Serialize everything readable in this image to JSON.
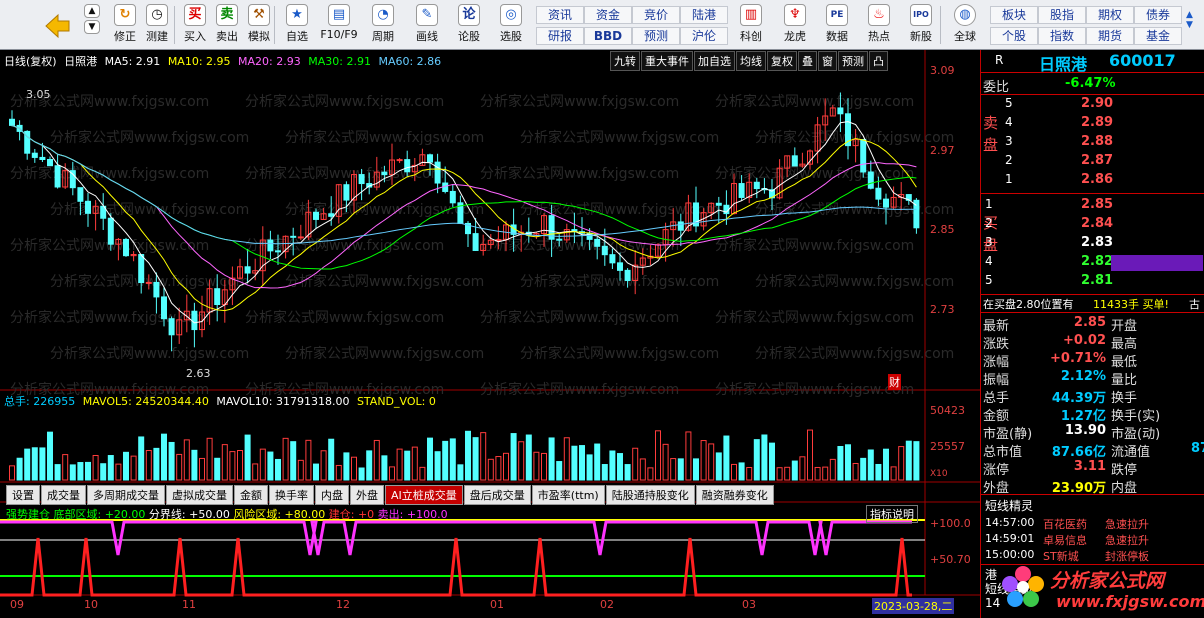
{
  "toolbar": {
    "items": [
      {
        "label": "修正",
        "icon": "refresh-icon"
      },
      {
        "label": "测建",
        "icon": "clock-icon"
      },
      {
        "label": "买入",
        "icon": "buy-icon"
      },
      {
        "label": "卖出",
        "icon": "sell-icon"
      },
      {
        "label": "模拟",
        "icon": "hammer-icon"
      },
      {
        "label": "自选",
        "icon": "star-icon"
      },
      {
        "label": "F10/F9",
        "icon": "doc-icon"
      },
      {
        "label": "周期",
        "icon": "cycle-icon"
      },
      {
        "label": "画线",
        "icon": "pencil-icon"
      },
      {
        "label": "论股",
        "icon": "discuss-icon"
      },
      {
        "label": "选股",
        "icon": "select-icon"
      },
      {
        "label": "科创",
        "icon": "chart-icon"
      },
      {
        "label": "龙虎",
        "icon": "dragon-icon"
      },
      {
        "label": "数据",
        "icon": "pe-icon"
      },
      {
        "label": "热点",
        "icon": "fire-icon"
      },
      {
        "label": "新股",
        "icon": "ipo-icon"
      },
      {
        "label": "全球",
        "icon": "globe-icon"
      }
    ],
    "small": [
      "资讯",
      "资金",
      "竞价",
      "陆港",
      "研报",
      "BBD",
      "预测",
      "沪伦",
      "板块",
      "股指",
      "期权",
      "债券",
      "个股",
      "指数",
      "期货",
      "基金"
    ],
    "buy_glyph": "买",
    "sell_glyph": "卖",
    "discuss_glyph": "论",
    "pe_glyph": "PE",
    "ipo_glyph": "IPO"
  },
  "chart": {
    "ma_title": "日线(复权)",
    "stock_name": "日照港",
    "ma": [
      {
        "t": "MA5: 2.91",
        "c": "#ffffff"
      },
      {
        "t": "MA10: 2.95",
        "c": "#ffff00"
      },
      {
        "t": "MA20: 2.93",
        "c": "#ff66ff"
      },
      {
        "t": "MA30: 2.91",
        "c": "#00ff00"
      },
      {
        "t": "MA60: 2.86",
        "c": "#66ccff"
      }
    ],
    "top_buttons": [
      "九转",
      "重大事件",
      "加自选",
      "均线",
      "复权",
      "叠",
      "窗",
      "预测",
      "凸"
    ],
    "price_axis": [
      "3.09",
      "2.97",
      "2.85",
      "2.73"
    ],
    "high_label": "3.05",
    "low_label": "2.63",
    "cai_label": "财",
    "vol_info": [
      {
        "t": "总手: 226955",
        "c": "#00c8ff"
      },
      {
        "t": "MAVOL5: 24520344.40",
        "c": "#ffff00"
      },
      {
        "t": "MAVOL10: 31791318.00",
        "c": "#ffffff"
      },
      {
        "t": "STAND_VOL: 0",
        "c": "#ffff00"
      }
    ],
    "vol_axis": [
      "50423",
      "25557",
      "X10"
    ],
    "tabs": [
      "设置",
      "成交量",
      "多周期成交量",
      "虚拟成交量",
      "金额",
      "换手率",
      "内盘",
      "外盘",
      "AI立桩成交量",
      "盘后成交量",
      "市盈率(ttm)",
      "陆股通持股变化",
      "融资融券变化"
    ],
    "tab_active": "AI立桩成交量",
    "ind": [
      {
        "t": "强势建仓 底部区域: +20.00",
        "c": "#00ff00"
      },
      {
        "t": "分界线: +50.00",
        "c": "#ffffff"
      },
      {
        "t": "风险区域: +80.00",
        "c": "#ffff00"
      },
      {
        "t": "建仓: +0",
        "c": "#ff3333"
      },
      {
        "t": "卖出: +100.0",
        "c": "#ff33ff"
      }
    ],
    "ind_button": "指标说明",
    "ind_axis": [
      "+100.0",
      "+50.70"
    ],
    "dates": [
      "09",
      "10",
      "11",
      "12",
      "01",
      "02",
      "03"
    ],
    "cur_date": "2023-03-28,二"
  },
  "quote": {
    "r": "R",
    "name": "日照港",
    "code": "600017",
    "weibi_label": "委比",
    "weibi": "-6.47%",
    "sell_label": "卖盘",
    "buy_label": "买盘",
    "sells": [
      {
        "n": "5",
        "p": "2.90"
      },
      {
        "n": "4",
        "p": "2.89"
      },
      {
        "n": "3",
        "p": "2.88"
      },
      {
        "n": "2",
        "p": "2.87"
      },
      {
        "n": "1",
        "p": "2.86"
      }
    ],
    "buys": [
      {
        "n": "1",
        "p": "2.85"
      },
      {
        "n": "2",
        "p": "2.84"
      },
      {
        "n": "3",
        "p": "2.83"
      },
      {
        "n": "4",
        "p": "2.82"
      },
      {
        "n": "5",
        "p": "2.81"
      }
    ],
    "notice": "在买盘2.80位置有",
    "notice2": "11433手 买单!",
    "notice3": "古",
    "stats": [
      {
        "l": "最新",
        "v": "2.85",
        "l2": "开盘"
      },
      {
        "l": "涨跌",
        "v": "+0.02",
        "l2": "最高"
      },
      {
        "l": "涨幅",
        "v": "+0.71%",
        "l2": "最低"
      },
      {
        "l": "振幅",
        "v": "2.12%",
        "l2": "量比"
      },
      {
        "l": "总手",
        "v": "44.39万",
        "l2": "换手"
      },
      {
        "l": "金额",
        "v": "1.27亿",
        "l2": "换手(实)"
      },
      {
        "l": "市盈(静)",
        "v": "13.90",
        "l2": "市盈(动)"
      },
      {
        "l": "总市值",
        "v": "87.66亿",
        "l2": "流通值",
        "v2": "87"
      },
      {
        "l": "涨停",
        "v": "3.11",
        "l2": "跌停"
      },
      {
        "l": "外盘",
        "v": "23.90万",
        "l2": "内盘"
      }
    ],
    "wizard": "短线精灵",
    "alerts": [
      {
        "t": "14:57:00",
        "n": "百花医药",
        "e": "急速拉升"
      },
      {
        "t": "14:59:01",
        "n": "卓易信息",
        "e": "急速拉升"
      },
      {
        "t": "15:00:00",
        "n": "ST新城",
        "e": "封涨停板"
      }
    ],
    "wizard2": "短线精灵",
    "port": "港",
    "fourteen": "14"
  },
  "watermark": {
    "text": "分析家公式网",
    "url": "www.fxjgsw.com",
    "bg": "分析家公式网www.fxjgsw.com"
  }
}
